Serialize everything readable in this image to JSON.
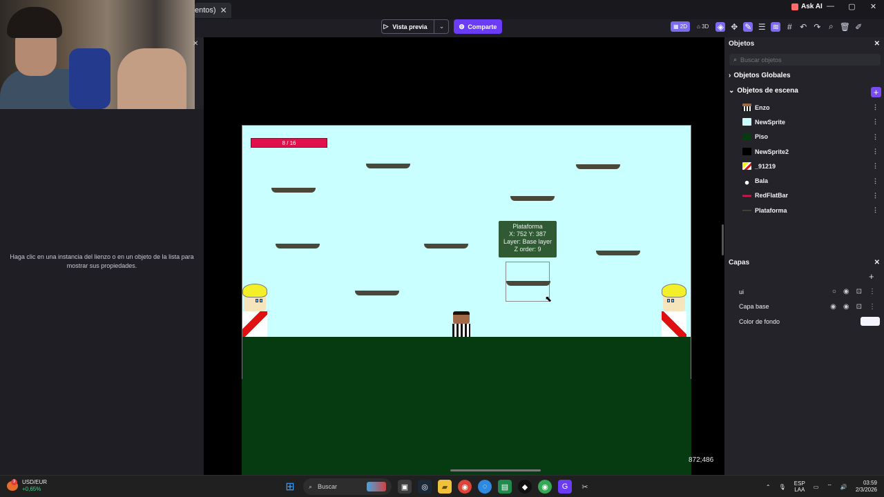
{
  "tab": {
    "title": "entos)",
    "close": "✕"
  },
  "window": {
    "ask_ai": "Ask AI",
    "minimize": "—",
    "maximize": "▢",
    "close": "✕"
  },
  "toolbar": {
    "preview_label": "Vista previa",
    "share_label": "Comparte",
    "mode_2d": "2D",
    "mode_3d": "3D"
  },
  "properties": {
    "hint": "Haga clic en una instancia del lienzo o en un objeto de la lista para mostrar sus propiedades."
  },
  "scene": {
    "hp_text": "8 / 16",
    "tooltip": {
      "name": "Plataforma",
      "coords": "X: 752  Y: 387",
      "layer": "Layer: Base layer",
      "zorder": "Z order: 9"
    },
    "cursor_readout": "872;486"
  },
  "objects_panel": {
    "title": "Objetos",
    "search_placeholder": "Buscar objetos",
    "global_group": "Objetos Globales",
    "scene_group": "Objetos de escena",
    "items": [
      {
        "name": "Enzo",
        "icon": "enzo-sprite-icon",
        "color": "#a06a49"
      },
      {
        "name": "NewSprite",
        "icon": "sprite-icon",
        "color": "#c9ffff"
      },
      {
        "name": "Piso",
        "icon": "sprite-icon",
        "color": "#063a10"
      },
      {
        "name": "NewSprite2",
        "icon": "sprite-icon",
        "color": "#000000"
      },
      {
        "name": "_91219",
        "icon": "enemy-sprite-icon",
        "color": "#f3f02a"
      },
      {
        "name": "Bala",
        "icon": "bullet-icon",
        "color": "#ffffff"
      },
      {
        "name": "RedFlatBar",
        "icon": "bar-icon",
        "color": "#e0104c"
      },
      {
        "name": "Plataforma",
        "icon": "platform-icon",
        "color": "#4a4838"
      }
    ]
  },
  "layers_panel": {
    "title": "Capas",
    "layers": [
      {
        "name": "ui"
      },
      {
        "name": "Capa base"
      }
    ],
    "bg_color_label": "Color de fondo"
  },
  "taskbar": {
    "ticker_pair": "USD/EUR",
    "ticker_change": "+0,65%",
    "ticker_badge": "3",
    "search_label": "Buscar",
    "lang_top": "ESP",
    "lang_bottom": "LAA",
    "time": "03:59",
    "date": "2/3/2026"
  },
  "colors": {
    "accent": "#6a3cf5",
    "scene_bg": "#c9ffff",
    "ground": "#063a10",
    "hp_bar": "#e0104c"
  }
}
